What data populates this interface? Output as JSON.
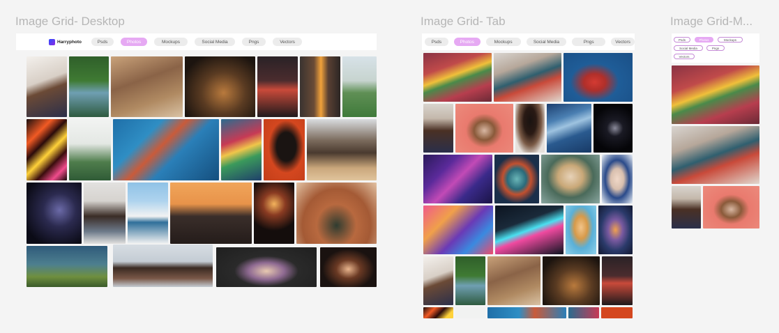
{
  "frames": {
    "desktop": {
      "title": "Image Grid- Desktop"
    },
    "tab": {
      "title": "Image Grid- Tab"
    },
    "mobile": {
      "title": "Image Grid-M..."
    }
  },
  "brand": {
    "name": "Harryphoto",
    "icon": "logo-icon"
  },
  "nav": {
    "items": [
      "Psds",
      "Photos",
      "Mockups",
      "Social Media",
      "Pngs",
      "Vectors"
    ],
    "active": "Photos"
  },
  "colors": {
    "active_pill": "#e6a9f3",
    "pill": "#ececec",
    "canvas": "#f4f4f4"
  }
}
